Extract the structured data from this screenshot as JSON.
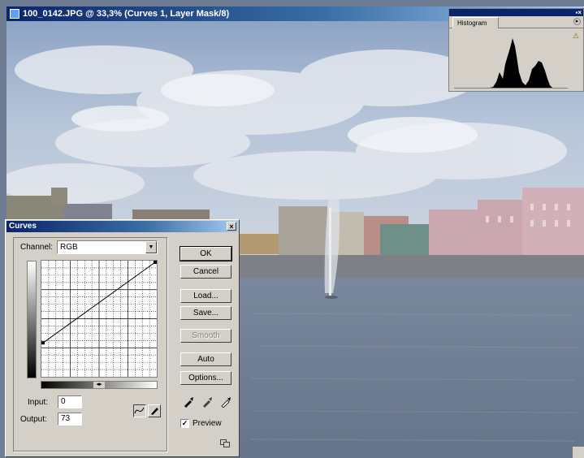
{
  "document": {
    "title": "100_0142.JPG @ 33,3% (Curves 1, Layer Mask/8)"
  },
  "histogram": {
    "tab_label": "Histogram",
    "menu_glyph": "▸",
    "warning_glyph": "⚠",
    "panel_buttons": "▪×"
  },
  "curves": {
    "title": "Curves",
    "close_glyph": "×",
    "channel_label": "Channel:",
    "channel_value": "RGB",
    "input_label": "Input:",
    "input_value": "0",
    "output_label": "Output:",
    "output_value": "73",
    "buttons": {
      "ok": "OK",
      "cancel": "Cancel",
      "load": "Load...",
      "save": "Save...",
      "smooth": "Smooth",
      "auto": "Auto",
      "options": "Options..."
    },
    "preview_label": "Preview",
    "preview_checked": true,
    "curve_points": [
      {
        "input": 0,
        "output": 73
      },
      {
        "input": 255,
        "output": 255
      }
    ]
  },
  "colors": {
    "titlebar_start": "#0a246a",
    "titlebar_end": "#a6caf0",
    "dialog_face": "#d4d0c8"
  }
}
